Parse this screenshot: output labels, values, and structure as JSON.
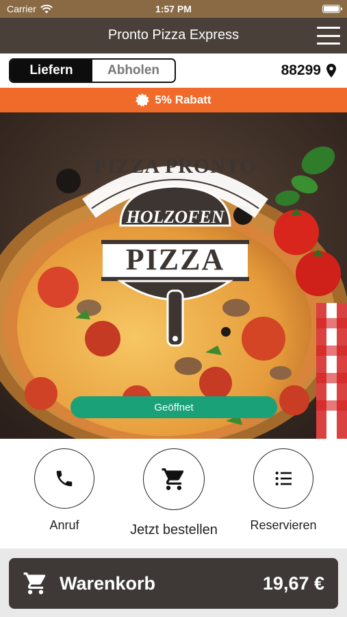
{
  "status_bar": {
    "carrier": "Carrier",
    "time": "1:57 PM"
  },
  "nav": {
    "title": "Pronto Pizza Express",
    "menu_icon": "hamburger-menu-icon"
  },
  "mode": {
    "delivery_label": "Liefern",
    "pickup_label": "Abholen",
    "selected": "Liefern"
  },
  "location": {
    "zip": "88299",
    "icon": "location-pin-icon"
  },
  "promo": {
    "text": "5% Rabatt",
    "icon": "discount-badge-icon",
    "color": "#f06a2a"
  },
  "hero": {
    "logo_arc_text": "PIZZA PRONTO",
    "logo_sub": "HOLZOFEN",
    "logo_main": "PIZZA",
    "status_label": "Geöffnet",
    "status_color": "#1ba178"
  },
  "actions": {
    "call_label": "Anruf",
    "order_label": "Jetzt bestellen",
    "reserve_label": "Reservieren"
  },
  "cart": {
    "label": "Warenkorb",
    "total": "19,67 €",
    "icon": "shopping-cart-icon"
  }
}
